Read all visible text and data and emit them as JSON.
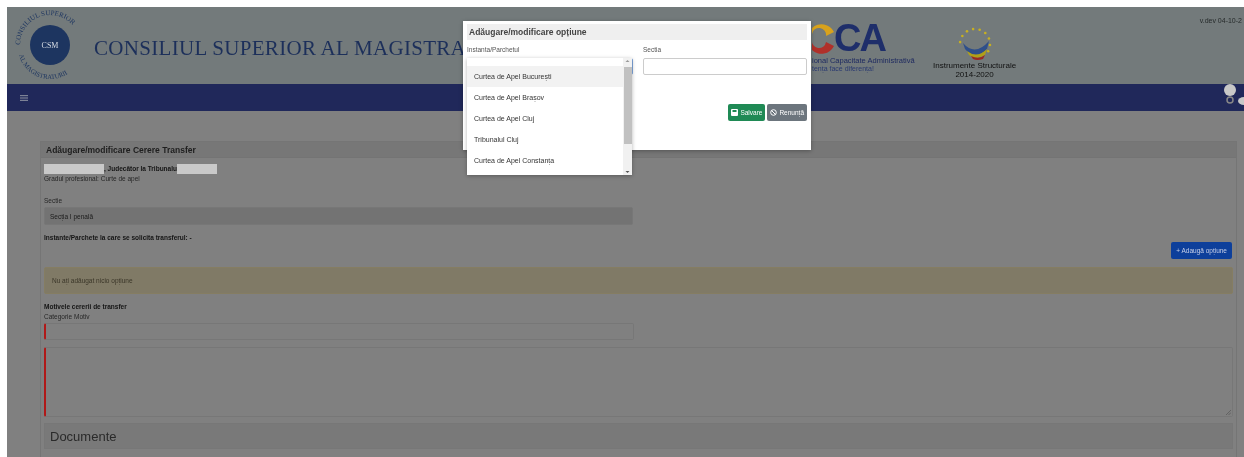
{
  "header": {
    "seal_top": "CONSILIUL SUPERIOR",
    "seal_bottom": "AL MAGISTRATURII",
    "seal_center": "CSM",
    "title": "CONSILIUL SUPERIOR AL MAGISTRA",
    "poca_mark": "CA",
    "poca_line_1": "ional Capacitate Administrativă",
    "poca_line_2": "tența face diferența!",
    "eu_line_1": "Instrumente Structurale",
    "eu_line_2": "2014-2020",
    "version": "v.dev 04-10-2"
  },
  "form": {
    "title": "Adăugare/modificare Cerere Transfer",
    "judge_role": ", Judecător la Tribunalu",
    "grade": "Gradul profesional: Curte de apel",
    "section_label": "Sectie",
    "section_value": "Secția I penală",
    "courts_label": "Instante/Parchete la care se solicita transferul: -",
    "add_button": "+ Adaugă opțiune",
    "empty_alert": "Nu ați adăugat nicio opțiune",
    "reasons_title": "Motivele cererii de transfer",
    "category_label": "Categorie Motiv",
    "documents_title": "Documente"
  },
  "dialog": {
    "title": "Adăugare/modificare opțiune",
    "court_label": "Instanta/Parchetul",
    "section_label": "Sectia",
    "save_button": "Salvare",
    "cancel_button": "Renunță",
    "options": [
      {
        "label": "Curtea de Apel București",
        "selected": true
      },
      {
        "label": "Curtea de Apel Brașov",
        "selected": false
      },
      {
        "label": "Curtea de Apel Cluj",
        "selected": false
      },
      {
        "label": "Tribunalul Cluj",
        "selected": false
      },
      {
        "label": "Curtea de Apel Constanța",
        "selected": false
      }
    ]
  }
}
